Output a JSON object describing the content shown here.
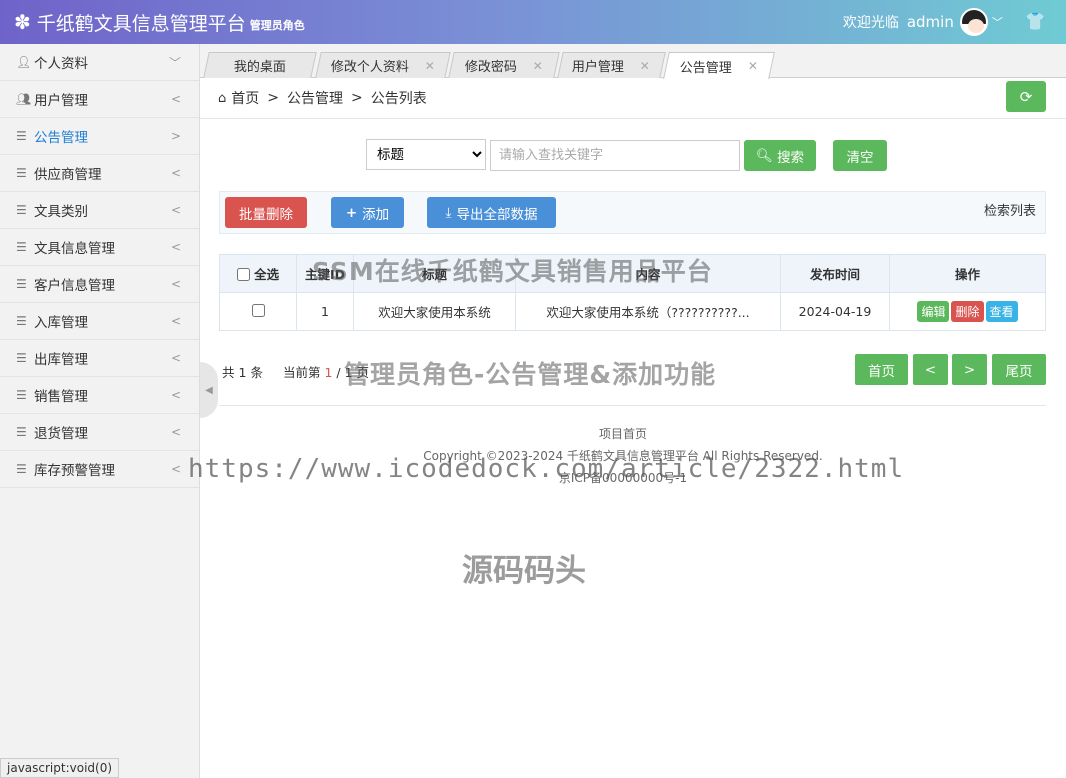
{
  "header": {
    "logo_icon": "gear-icon",
    "title": "千纸鹤文具信息管理平台",
    "role": "管理员角色",
    "welcome": "欢迎光临",
    "username": "admin",
    "theme_icon": "tshirt-icon"
  },
  "sidebar": {
    "items": [
      {
        "label": "个人资料",
        "icon": "user-icon",
        "arrow": "chevron-down"
      },
      {
        "label": "用户管理",
        "icon": "users-icon",
        "arrow": "chevron-left"
      },
      {
        "label": "公告管理",
        "icon": "list-icon",
        "arrow": "chevron-right",
        "active": true
      },
      {
        "label": "供应商管理",
        "icon": "list-icon",
        "arrow": "chevron-left"
      },
      {
        "label": "文具类别",
        "icon": "list-icon",
        "arrow": "chevron-left"
      },
      {
        "label": "文具信息管理",
        "icon": "list-icon",
        "arrow": "chevron-left"
      },
      {
        "label": "客户信息管理",
        "icon": "list-icon",
        "arrow": "chevron-left"
      },
      {
        "label": "入库管理",
        "icon": "list-icon",
        "arrow": "chevron-left"
      },
      {
        "label": "出库管理",
        "icon": "list-icon",
        "arrow": "chevron-left"
      },
      {
        "label": "销售管理",
        "icon": "list-icon",
        "arrow": "chevron-left"
      },
      {
        "label": "退货管理",
        "icon": "list-icon",
        "arrow": "chevron-left"
      },
      {
        "label": "库存预警管理",
        "icon": "list-icon",
        "arrow": "chevron-left"
      }
    ]
  },
  "tabs": [
    {
      "label": "我的桌面",
      "closable": false
    },
    {
      "label": "修改个人资料",
      "closable": true
    },
    {
      "label": "修改密码",
      "closable": true
    },
    {
      "label": "用户管理",
      "closable": true
    },
    {
      "label": "公告管理",
      "closable": true,
      "active": true
    }
  ],
  "breadcrumb": {
    "home": "首页",
    "level1": "公告管理",
    "level2": "公告列表",
    "separator": ">"
  },
  "search": {
    "field_selected": "标题",
    "field_options": [
      "标题"
    ],
    "placeholder": "请输入查找关键字",
    "search_label": "搜索",
    "clear_label": "清空"
  },
  "actions": {
    "batch_delete": "批量删除",
    "add": "添加",
    "export": "导出全部数据",
    "panel_title": "检索列表"
  },
  "table": {
    "headers": {
      "select_all": "全选",
      "id": "主键ID",
      "title": "标题",
      "content": "内容",
      "publish_time": "发布时间",
      "operations": "操作"
    },
    "rows": [
      {
        "id": "1",
        "title": "欢迎大家使用本系统",
        "content": "欢迎大家使用本系统（??????????...",
        "publish_time": "2024-04-19",
        "edit": "编辑",
        "delete": "删除",
        "view": "查看"
      }
    ]
  },
  "pagination": {
    "total_prefix": "共",
    "total": "1",
    "total_suffix": "条",
    "current_prefix": "当前第",
    "current": "1",
    "page_sep": "/",
    "pages": "1",
    "pages_suffix": "页",
    "first": "首页",
    "prev": "<",
    "next": ">",
    "last": "尾页"
  },
  "footer": {
    "link": "项目首页",
    "copyright": "Copyright ©2023-2024 千纸鹤文具信息管理平台 All Rights Reserved.",
    "icp": "京ICP备00000000号-1"
  },
  "watermarks": {
    "line1": "SSM在线千纸鹤文具销售用品平台",
    "line2": "管理员角色-公告管理&添加功能",
    "url": "https://www.icodedock.com/article/2322.html",
    "brand": "源码码头"
  },
  "statusbar": "javascript:void(0)",
  "colors": {
    "header_start": "#6f63c9",
    "header_end": "#6fcbd3",
    "success": "#5cb85c",
    "danger": "#d9534f",
    "primary": "#4a90d9",
    "info": "#39b2e6",
    "active_menu": "#1e7ed6"
  }
}
